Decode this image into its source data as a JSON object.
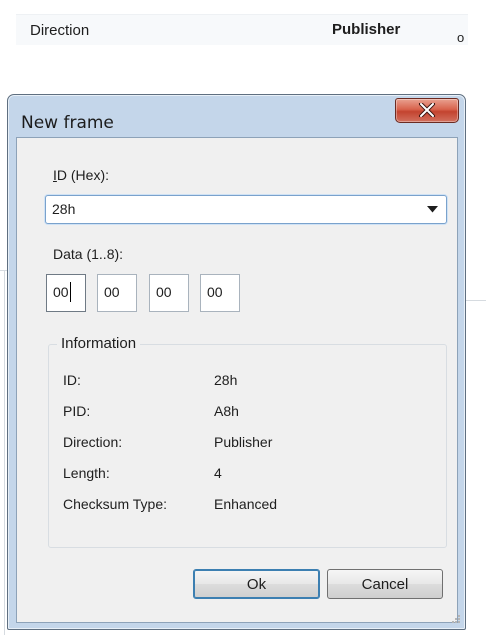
{
  "header": {
    "direction_label": "Direction",
    "publisher_label": "Publisher",
    "bullet": "o"
  },
  "dialog": {
    "title": "New frame",
    "id_label": "ID (Hex):",
    "id_label_accel": "I",
    "id_label_rest": "D (Hex):",
    "id_value": "28h",
    "data_label": "Data (1..8):",
    "data_bytes": [
      "00",
      "00",
      "00",
      "00"
    ],
    "information": {
      "title": "Information",
      "rows": [
        {
          "key": "ID:",
          "value": "28h"
        },
        {
          "key": "PID:",
          "value": "A8h"
        },
        {
          "key": "Direction:",
          "value": "Publisher"
        },
        {
          "key": "Length:",
          "value": "4"
        },
        {
          "key": "Checksum Type:",
          "value": "Enhanced"
        }
      ]
    },
    "ok_label": "Ok",
    "cancel_label": "Cancel"
  },
  "icons": {
    "close": "close-icon",
    "dropdown": "chevron-down-icon",
    "resize": "resize-grip-icon"
  },
  "colors": {
    "window_frame": "#c4d6ea",
    "close_button": "#c3432f",
    "client_background": "#f0f0f0",
    "focus_border": "#3c7fb1"
  }
}
